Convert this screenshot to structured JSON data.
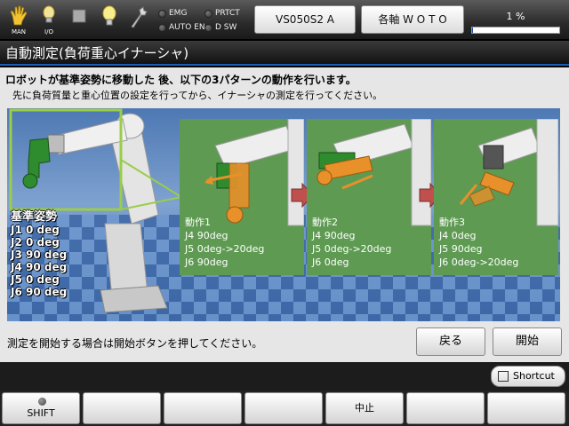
{
  "topbar": {
    "mode_label": "MAN",
    "io_label": "I/O",
    "status_indicators": [
      {
        "label": "EMG"
      },
      {
        "label": "PRTCT"
      },
      {
        "label": "AUTO EN"
      },
      {
        "label": "D SW"
      }
    ],
    "robot_model": "VS050S2 A",
    "jog_mode": "各軸 W O T O",
    "speed_text": "1 %",
    "speed_percent": 1
  },
  "page_title": "自動測定(負荷重心イナーシャ)",
  "main": {
    "heading": "ロボットが基準姿勢に移動した 後、以下の3パターンの動作を行います。",
    "subheading": "先に負荷質量と重心位置の設定を行ってから、イナーシャの測定を行ってください。",
    "base_pose": {
      "title": "基準姿勢",
      "joints": [
        "J1  0 deg",
        "J2  0 deg",
        "J3  90 deg",
        "J4  90 deg",
        "J5  0 deg",
        "J6  90 deg"
      ]
    },
    "motions": [
      {
        "title": "動作1",
        "lines": [
          "J4  90deg",
          "J5  0deg->20deg",
          "J6  90deg"
        ]
      },
      {
        "title": "動作2",
        "lines": [
          "J4  90deg",
          "J5  0deg->20deg",
          "J6  0deg"
        ]
      },
      {
        "title": "動作3",
        "lines": [
          "J4  0deg",
          "J5  90deg",
          "J6  0deg->20deg"
        ]
      }
    ],
    "prompt": "測定を開始する場合は開始ボタンを押してください。",
    "back_label": "戻る",
    "start_label": "開始"
  },
  "bottom": {
    "shortcut_label": "Shortcut",
    "function_keys": [
      "SHIFT",
      "",
      "",
      "",
      "中止",
      "",
      ""
    ]
  },
  "colors": {
    "title_accent": "#1a5fb4",
    "robot_green": "#2e8b2e",
    "motion_orange": "#e8912a",
    "arrow_red": "#c0504d",
    "panel_green": "#5e9a52",
    "highlight_frame": "#9acd4a"
  }
}
